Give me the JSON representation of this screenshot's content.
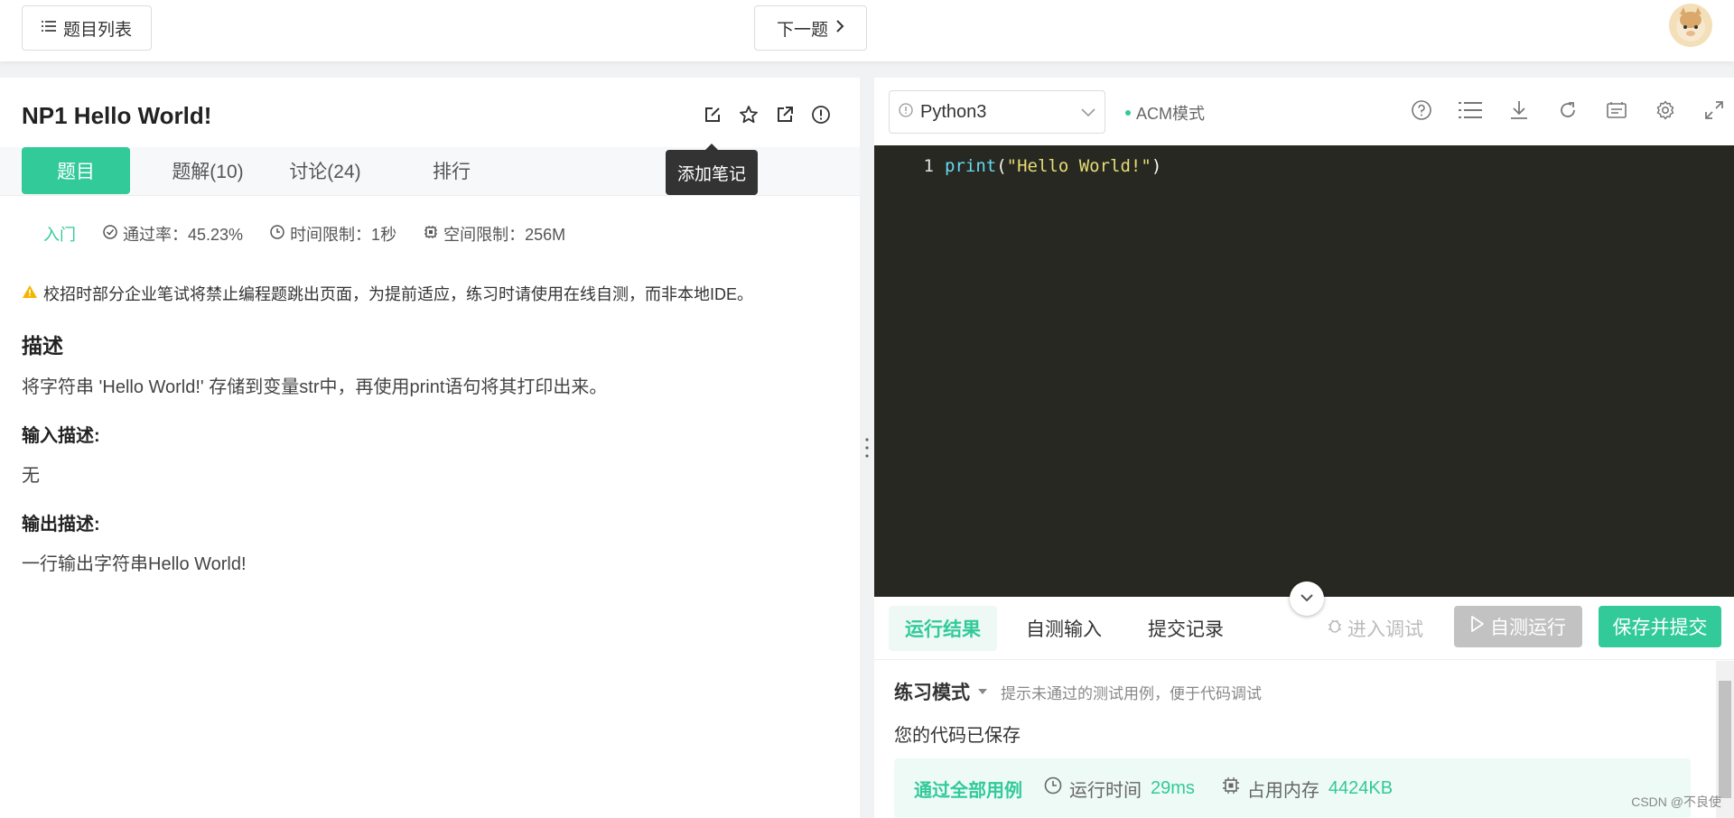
{
  "topbar": {
    "problem_list": "题目列表",
    "next": "下一题"
  },
  "problem": {
    "title": "NP1  Hello World!",
    "tooltip": "添加笔记",
    "tabs": [
      "题目",
      "题解(10)",
      "讨论(24)",
      "排行"
    ],
    "level": "入门",
    "pass_rate": "通过率：45.23%",
    "time_limit": "时间限制：1秒",
    "space_limit": "空间限制：256M",
    "warning": "校招时部分企业笔试将禁止编程题跳出页面，为提前适应，练习时请使用在线自测，而非本地IDE。",
    "desc_heading": "描述",
    "desc_text": "将字符串 'Hello World!' 存储到变量str中，再使用print语句将其打印出来。",
    "input_heading": "输入描述:",
    "input_text": "无",
    "output_heading": "输出描述:",
    "output_text": "一行输出字符串Hello World!"
  },
  "editor": {
    "language": "Python3",
    "mode": "ACM模式",
    "line_number": "1",
    "code_fn": "print",
    "code_open": "(",
    "code_str": "\"Hello World!\"",
    "code_close": ")"
  },
  "result": {
    "tabs": [
      "运行结果",
      "自测输入",
      "提交记录"
    ],
    "debug": "进入调试",
    "run": "自测运行",
    "submit": "保存并提交",
    "mode": "练习模式",
    "mode_hint": "提示未通过的测试用例，便于代码调试",
    "saved": "您的代码已保存",
    "pass_title": "通过全部用例",
    "runtime_label": "运行时间",
    "runtime_value": "29ms",
    "memory_label": "占用内存",
    "memory_value": "4424KB"
  },
  "watermark": "CSDN @不良使",
  "colors": {
    "accent": "#32ca99",
    "editor_bg": "#272822",
    "tooltip_bg": "#333333"
  }
}
